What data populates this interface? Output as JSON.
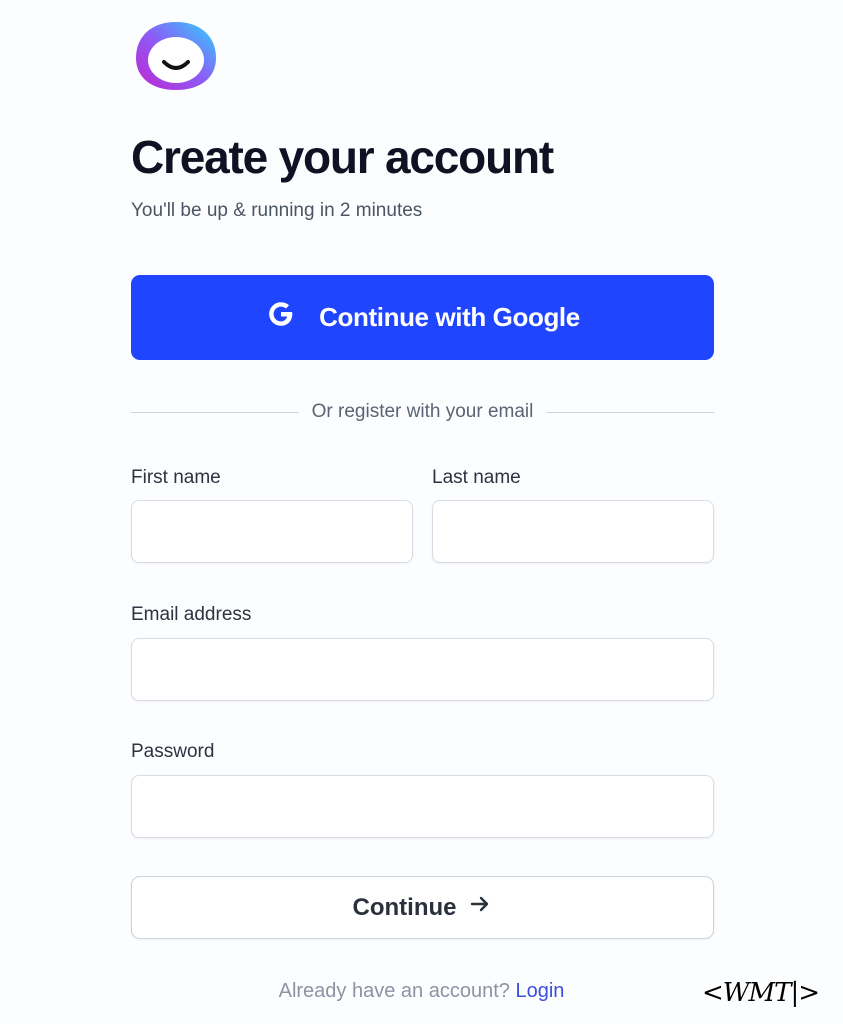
{
  "logo": {
    "icon": "smiling-face-logo-icon",
    "gradient": [
      "#2fd3ff",
      "#8b5cf6",
      "#c026d3"
    ]
  },
  "heading": {
    "title": "Create your account",
    "subtitle": "You'll be up & running in 2 minutes"
  },
  "google_button": {
    "label": "Continue with Google",
    "icon": "google-g-icon",
    "color": "#1f45ff"
  },
  "divider": {
    "text": "Or register with your email"
  },
  "form": {
    "first_name": {
      "label": "First name",
      "value": "",
      "placeholder": ""
    },
    "last_name": {
      "label": "Last name",
      "value": "",
      "placeholder": ""
    },
    "email": {
      "label": "Email address",
      "value": "",
      "placeholder": ""
    },
    "password": {
      "label": "Password",
      "value": "",
      "placeholder": ""
    }
  },
  "continue_button": {
    "label": "Continue",
    "icon": "arrow-right-icon"
  },
  "footer": {
    "prompt": "Already have an account?",
    "link": "Login"
  },
  "watermark": {
    "text": "<WMT|>"
  }
}
